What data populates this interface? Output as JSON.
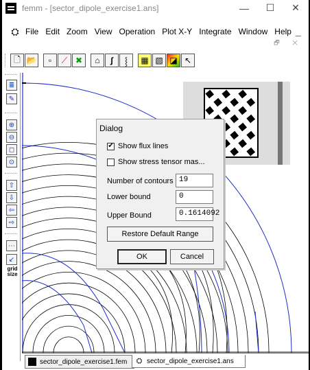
{
  "window": {
    "title": "femm - [sector_dipole_exercise1.ans]",
    "min_glyph": "—",
    "max_glyph": "☐",
    "close_glyph": "✕"
  },
  "menu": {
    "items": [
      "File",
      "Edit",
      "Zoom",
      "View",
      "Operation",
      "Plot X-Y",
      "Integrate",
      "Window",
      "Help"
    ],
    "child_min": "_",
    "child_controls": "🗗 ✕"
  },
  "toolbar": {
    "glyphs": [
      "🗋",
      "📂",
      "▫",
      "⟋",
      "✖",
      "⌂",
      "∫",
      "⸾",
      "▦",
      "▧",
      "◪",
      "↖"
    ]
  },
  "lefttb": {
    "glyphs": [
      "≣",
      "✎",
      "⊕",
      "⊖",
      "◻",
      "⊙",
      "⇧",
      "⇩",
      "⇦",
      "⇨",
      "⋯",
      "↙"
    ],
    "grid_label_1": "grid",
    "grid_label_2": "size"
  },
  "dialog": {
    "title": "Dialog",
    "show_flux_lines": {
      "label": "Show flux lines",
      "checked": true,
      "mark": "✔"
    },
    "show_stress_tensor": {
      "label": "Show stress tensor mas...",
      "checked": false
    },
    "contours": {
      "label": "Number of contours",
      "value": "19"
    },
    "lower": {
      "label": "Lower bound",
      "value": "0"
    },
    "upper": {
      "label": "Upper Bound",
      "value": "0.1614092"
    },
    "restore_label": "Restore Default Range",
    "ok_label": "OK",
    "cancel_label": "Cancel"
  },
  "tabs": [
    {
      "label": "sector_dipole_exercise1.fem",
      "active": false
    },
    {
      "label": "sector_dipole_exercise1.ans",
      "active": true
    }
  ],
  "colors": {
    "boundary_blue": "#1d2cc9",
    "contour_black": "#000000",
    "dialog_bg": "#f0f0f0"
  }
}
